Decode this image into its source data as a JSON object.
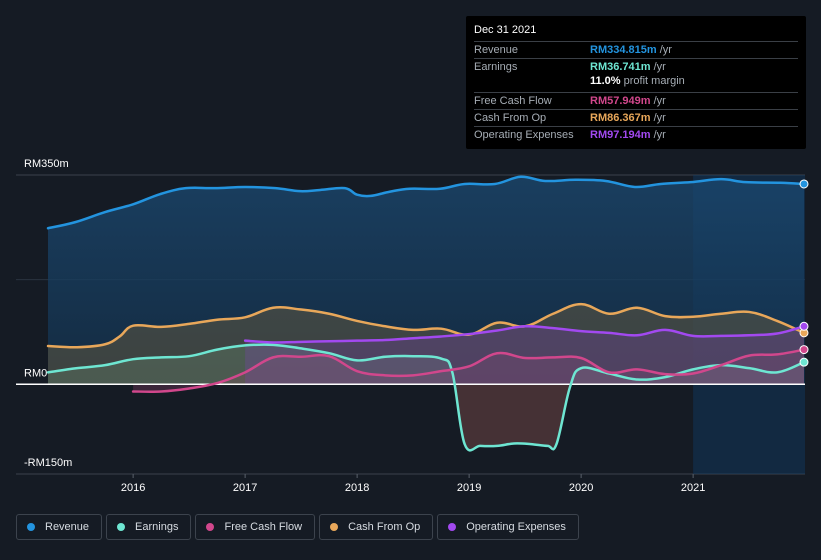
{
  "tooltip": {
    "date": "Dec 31 2021",
    "rows": [
      {
        "label": "Revenue",
        "value": "RM334.815m",
        "unit": " /yr",
        "color": "#2394df"
      },
      {
        "label": "Earnings",
        "value": "RM36.741m",
        "unit": " /yr",
        "color": "#6ee6d2"
      },
      {
        "label": "Free Cash Flow",
        "value": "RM57.949m",
        "unit": " /yr",
        "color": "#d1478c"
      },
      {
        "label": "Cash From Op",
        "value": "RM86.367m",
        "unit": " /yr",
        "color": "#e8a75a"
      },
      {
        "label": "Operating Expenses",
        "value": "RM97.194m",
        "unit": " /yr",
        "color": "#a249f0"
      }
    ],
    "profit_margin_value": "11.0%",
    "profit_margin_label": " profit margin"
  },
  "legend": [
    {
      "label": "Revenue",
      "color": "#2394df"
    },
    {
      "label": "Earnings",
      "color": "#6ee6d2"
    },
    {
      "label": "Free Cash Flow",
      "color": "#d1478c"
    },
    {
      "label": "Cash From Op",
      "color": "#e8a75a"
    },
    {
      "label": "Operating Expenses",
      "color": "#a249f0"
    }
  ],
  "chart_data": {
    "type": "area",
    "title": "",
    "xlabel": "",
    "ylabel": "",
    "unit": "RM m",
    "xlim": [
      2015.24,
      2021.99
    ],
    "ylim": [
      -150,
      350
    ],
    "y_tick_labels": [
      {
        "value": 350,
        "label": "RM350m"
      },
      {
        "value": 0,
        "label": "RM0"
      },
      {
        "value": -150,
        "label": "-RM150m"
      }
    ],
    "x_ticks": [
      2016,
      2017,
      2018,
      2019,
      2020,
      2021
    ],
    "x_tick_labels": [
      "2016",
      "2017",
      "2018",
      "2019",
      "2020",
      "2021"
    ],
    "highlight_from": 2021.0,
    "grid": true,
    "legend_position": "bottom-left",
    "series": [
      {
        "name": "Revenue",
        "color": "#2394df",
        "x": [
          2015.24,
          2015.48,
          2015.75,
          2016.0,
          2016.24,
          2016.47,
          2016.73,
          2017.0,
          2017.27,
          2017.49,
          2017.67,
          2017.89,
          2018.0,
          2018.12,
          2018.29,
          2018.47,
          2018.74,
          2018.96,
          2019.23,
          2019.46,
          2019.68,
          2019.95,
          2020.22,
          2020.48,
          2020.71,
          2020.98,
          2021.25,
          2021.47,
          2021.78,
          2021.99
        ],
        "y": [
          261,
          271,
          288,
          301,
          318,
          328,
          328,
          330,
          328,
          323,
          325,
          328,
          317,
          315,
          322,
          327,
          327,
          335,
          335,
          347,
          340,
          342,
          340,
          330,
          335,
          338,
          343,
          338,
          337,
          335
        ]
      },
      {
        "name": "Earnings",
        "color": "#6ee6d2",
        "x": [
          2015.24,
          2015.5,
          2015.75,
          2016.0,
          2016.25,
          2016.5,
          2016.75,
          2017.0,
          2017.25,
          2017.5,
          2017.75,
          2018.0,
          2018.25,
          2018.5,
          2018.75,
          2018.85,
          2018.96,
          2019.1,
          2019.25,
          2019.4,
          2019.55,
          2019.7,
          2019.78,
          2019.9,
          2020.0,
          2020.25,
          2020.5,
          2020.75,
          2021.0,
          2021.25,
          2021.5,
          2021.75,
          2021.99
        ],
        "y": [
          20,
          27,
          32,
          42,
          45,
          47,
          58,
          65,
          66,
          60,
          52,
          40,
          46,
          47,
          43,
          20,
          -100,
          -103,
          -103,
          -99,
          -100,
          -103,
          -100,
          -5,
          27,
          18,
          8,
          12,
          25,
          32,
          27,
          20,
          37
        ]
      },
      {
        "name": "Free Cash Flow",
        "color": "#d1478c",
        "x": [
          2016.0,
          2016.25,
          2016.5,
          2016.75,
          2017.0,
          2017.25,
          2017.5,
          2017.75,
          2018.0,
          2018.25,
          2018.5,
          2018.75,
          2019.0,
          2019.25,
          2019.5,
          2019.75,
          2020.0,
          2020.25,
          2020.5,
          2020.75,
          2021.0,
          2021.25,
          2021.5,
          2021.75,
          2021.99
        ],
        "y": [
          -12,
          -12,
          -7,
          2,
          20,
          45,
          46,
          47,
          22,
          15,
          15,
          22,
          30,
          52,
          44,
          45,
          44,
          20,
          25,
          17,
          18,
          32,
          48,
          50,
          58
        ]
      },
      {
        "name": "Cash From Op",
        "color": "#e8a75a",
        "x": [
          2015.24,
          2015.5,
          2015.75,
          2015.88,
          2016.0,
          2016.25,
          2016.5,
          2016.75,
          2017.0,
          2017.25,
          2017.5,
          2017.75,
          2018.0,
          2018.25,
          2018.5,
          2018.75,
          2019.0,
          2019.25,
          2019.5,
          2019.75,
          2020.0,
          2020.25,
          2020.5,
          2020.75,
          2021.0,
          2021.25,
          2021.5,
          2021.75,
          2021.99
        ],
        "y": [
          64,
          62,
          67,
          80,
          98,
          96,
          101,
          108,
          112,
          128,
          125,
          118,
          106,
          97,
          91,
          93,
          83,
          103,
          97,
          118,
          134,
          118,
          128,
          114,
          113,
          118,
          121,
          106,
          86
        ]
      },
      {
        "name": "Operating Expenses",
        "color": "#a249f0",
        "x": [
          2017.0,
          2017.25,
          2017.5,
          2017.75,
          2018.0,
          2018.25,
          2018.5,
          2018.75,
          2019.0,
          2019.25,
          2019.5,
          2019.75,
          2020.0,
          2020.25,
          2020.5,
          2020.75,
          2021.0,
          2021.25,
          2021.5,
          2021.75,
          2021.99
        ],
        "y": [
          73,
          70,
          71,
          72,
          73,
          74,
          77,
          80,
          84,
          90,
          97,
          94,
          89,
          86,
          82,
          91,
          81,
          81,
          82,
          85,
          97
        ]
      }
    ]
  }
}
